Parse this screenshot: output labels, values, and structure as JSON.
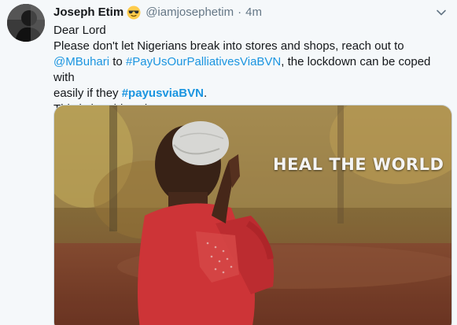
{
  "tweet": {
    "author_name": "Joseph Etim",
    "author_emoji": "sunglasses-emoji",
    "handle": "@iamjosephetim",
    "separator": "·",
    "time": "4m",
    "line1": "Dear Lord",
    "line2_part1": "Please don't let Nigerians break into stores and shops, reach out to",
    "mention": "@MBuhari",
    "line3_to": " to ",
    "hashtag1": "#PayUsOurPalliativesViaBVN",
    "line3_part2": ", the lockdown can be coped with",
    "line4_part1": "easily if they ",
    "hashtag2": "#payusviaBVN",
    "line4_part2": ".",
    "line5": "This is humbly ask"
  },
  "media": {
    "overlay_text": "HEAL THE WORLD"
  },
  "colors": {
    "link": "#1b95e0",
    "text": "#14171a",
    "muted": "#657786",
    "background": "#f5f8fa"
  }
}
